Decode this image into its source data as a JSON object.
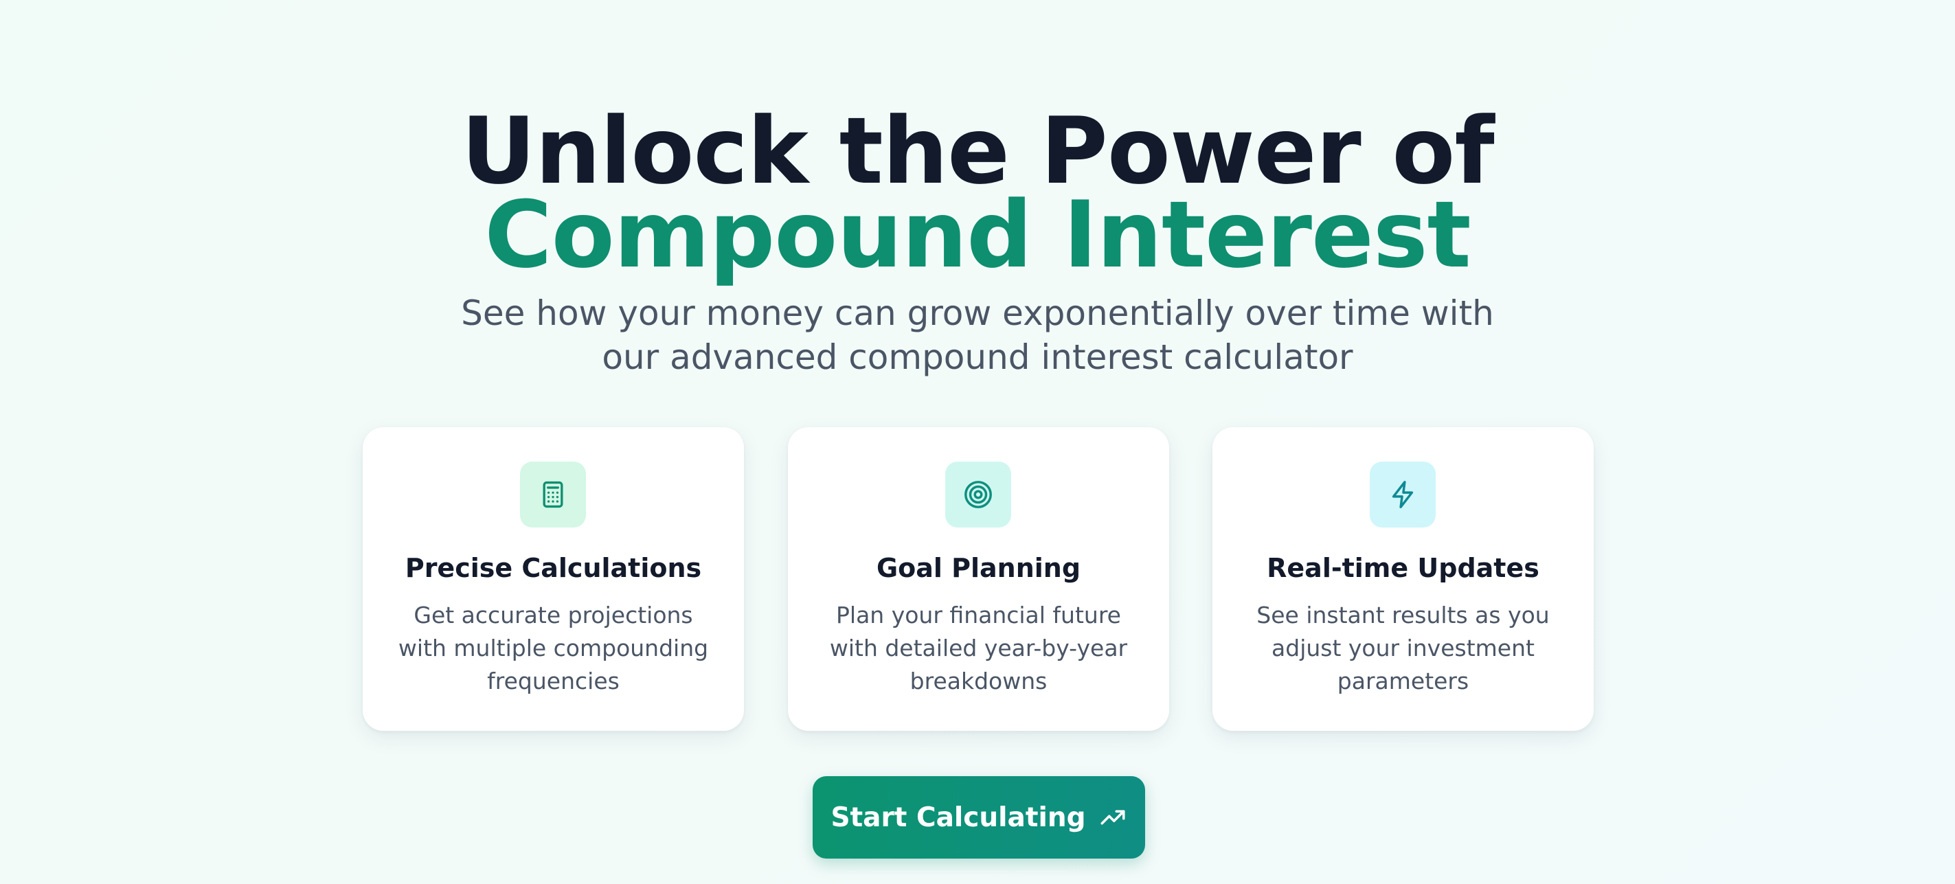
{
  "hero": {
    "title_line1": "Unlock the Power of",
    "title_line2": "Compound Interest",
    "subtitle": "See how your money can grow exponentially over time with our advanced compound interest calculator"
  },
  "features": [
    {
      "icon": "calculator-icon",
      "title": "Precise Calculations",
      "description": "Get accurate projections with multiple compounding frequencies"
    },
    {
      "icon": "target-icon",
      "title": "Goal Planning",
      "description": "Plan your financial future with detailed year-by-year breakdowns"
    },
    {
      "icon": "lightning-icon",
      "title": "Real-time Updates",
      "description": "See instant results as you adjust your investment parameters"
    }
  ],
  "cta": {
    "label": "Start Calculating",
    "icon": "trending-up-icon"
  },
  "colors": {
    "accent": "#0e8f6f",
    "heading": "#121a2b",
    "body_text": "#4a5565",
    "icon_bg_green": "#d4f7e6",
    "icon_bg_teal": "#cff7f0",
    "icon_bg_cyan": "#cff6fa"
  }
}
